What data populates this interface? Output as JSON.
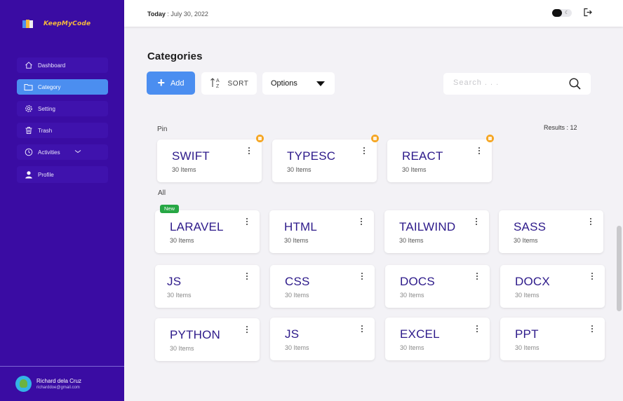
{
  "app": {
    "name": "KeepMyCode"
  },
  "sidebar": {
    "items": [
      {
        "label": "Dashboard",
        "icon": "home-icon"
      },
      {
        "label": "Category",
        "icon": "folder-icon",
        "active": true
      },
      {
        "label": "Setting",
        "icon": "gear-icon"
      },
      {
        "label": "Trash",
        "icon": "trash-icon"
      },
      {
        "label": "Activities",
        "icon": "clock-icon"
      },
      {
        "label": "Profile",
        "icon": "user-icon"
      }
    ],
    "user": {
      "name": "Richard dela Cruz",
      "email": "richarddoe@gmail.com"
    }
  },
  "header": {
    "today_label": "Today",
    "date": " : July 30, 2022"
  },
  "main": {
    "title": "Categories",
    "add_label": "Add",
    "sort_label": "SORT",
    "options_label": "Options",
    "search_placeholder": "Search . . .",
    "pin_label": "Pin",
    "all_label": "All",
    "results": "Results : 12",
    "new_badge": "New",
    "pinned": [
      {
        "title": "SWIFT",
        "count": "30 Items"
      },
      {
        "title": "TYPESC",
        "count": "30 Items"
      },
      {
        "title": "REACT",
        "count": "30 Items"
      }
    ],
    "all": [
      {
        "title": "LARAVEL",
        "count": "30 Items"
      },
      {
        "title": "HTML",
        "count": "30 Items"
      },
      {
        "title": "TAILWIND",
        "count": "30 Items"
      },
      {
        "title": "SASS",
        "count": "30 Items"
      },
      {
        "title": "JS",
        "count": "30 Items"
      },
      {
        "title": "CSS",
        "count": "30 Items"
      },
      {
        "title": "DOCS",
        "count": "30 Items"
      },
      {
        "title": "DOCX",
        "count": "30 Items"
      },
      {
        "title": "PYTHON",
        "count": "30 Items"
      },
      {
        "title": "JS",
        "count": "30 Items"
      },
      {
        "title": "EXCEL",
        "count": "30 Items"
      },
      {
        "title": "PPT",
        "count": "30 Items"
      }
    ]
  },
  "colors": {
    "sidebar": "#3a0ca3",
    "accent": "#4b8ef0",
    "pin": "#f5a623",
    "new": "#27a745",
    "card_title": "#2d1a8a"
  }
}
